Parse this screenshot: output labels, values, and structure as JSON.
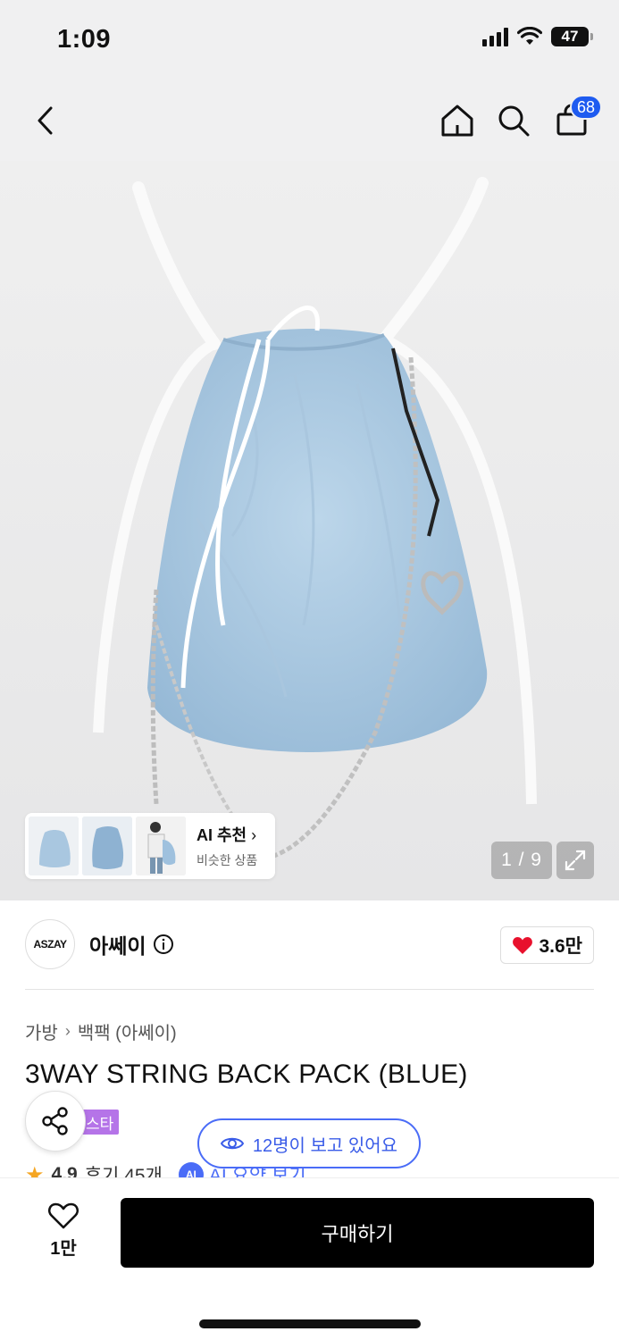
{
  "status_bar": {
    "time": "1:09",
    "battery": "47"
  },
  "nav": {
    "cart_count": "68",
    "icons": [
      "back-icon",
      "home-icon",
      "search-icon",
      "cart-icon"
    ]
  },
  "gallery": {
    "ai_rec_title": "AI 추천",
    "ai_rec_sub": "비슷한 상품",
    "counter": "1 / 9"
  },
  "brand": {
    "logo_text": "ASZAY",
    "name": "아쎄이",
    "likes": "3.6만"
  },
  "breadcrumb": {
    "category": "가방",
    "sub": "백팩 (아쎄이)"
  },
  "product": {
    "title": "3WAY STRING BACK PACK (BLUE)",
    "tag": "스타",
    "rating": "4.9",
    "reviews": "후기 45개",
    "ai_summary": "AI 요약 보기"
  },
  "viewers": "12명이 보고 있어요",
  "bottom": {
    "wish_count": "1만",
    "buy_label": "구매하기"
  },
  "colors": {
    "accent": "#4a6cf7",
    "badge": "#1e5bf0",
    "heart": "#e8112d",
    "tag": "#b574e8"
  }
}
